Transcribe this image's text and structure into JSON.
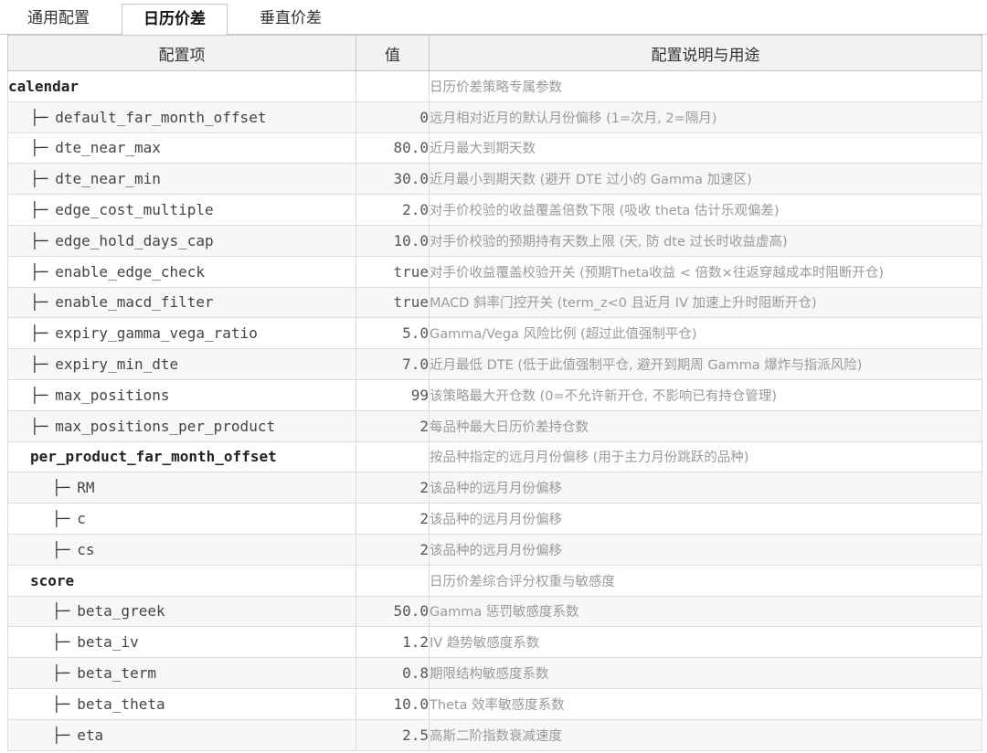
{
  "tabs": [
    {
      "label": "通用配置",
      "active": false
    },
    {
      "label": "日历价差",
      "active": true
    },
    {
      "label": "垂直价差",
      "active": false
    }
  ],
  "table": {
    "headers": {
      "key": "配置项",
      "value": "值",
      "description": "配置说明与用途"
    },
    "branch_glyph": "├─",
    "rows": [
      {
        "level": 0,
        "section": true,
        "key": "calendar",
        "value": "",
        "description": "日历价差策略专属参数"
      },
      {
        "level": 1,
        "section": false,
        "key": "default_far_month_offset",
        "value": "0",
        "description": "远月相对近月的默认月份偏移 (1=次月, 2=隔月)"
      },
      {
        "level": 1,
        "section": false,
        "key": "dte_near_max",
        "value": "80.0",
        "description": "近月最大到期天数"
      },
      {
        "level": 1,
        "section": false,
        "key": "dte_near_min",
        "value": "30.0",
        "description": "近月最小到期天数 (避开 DTE 过小的 Gamma 加速区)"
      },
      {
        "level": 1,
        "section": false,
        "key": "edge_cost_multiple",
        "value": "2.0",
        "description": "对手价校验的收益覆盖倍数下限 (吸收 theta 估计乐观偏差)"
      },
      {
        "level": 1,
        "section": false,
        "key": "edge_hold_days_cap",
        "value": "10.0",
        "description": "对手价校验的预期持有天数上限 (天, 防 dte 过长时收益虚高)"
      },
      {
        "level": 1,
        "section": false,
        "key": "enable_edge_check",
        "value": "true",
        "description": "对手价收益覆盖校验开关 (预期Theta收益 < 倍数×往返穿越成本时阻断开仓)"
      },
      {
        "level": 1,
        "section": false,
        "key": "enable_macd_filter",
        "value": "true",
        "description": "MACD 斜率门控开关 (term_z<0 且近月 IV 加速上升时阻断开仓)"
      },
      {
        "level": 1,
        "section": false,
        "key": "expiry_gamma_vega_ratio",
        "value": "5.0",
        "description": "Gamma/Vega 风险比例 (超过此值强制平仓)"
      },
      {
        "level": 1,
        "section": false,
        "key": "expiry_min_dte",
        "value": "7.0",
        "description": "近月最低 DTE (低于此值强制平仓, 避开到期周 Gamma 爆炸与指派风险)"
      },
      {
        "level": 1,
        "section": false,
        "key": "max_positions",
        "value": "99",
        "description": "该策略最大开仓数 (0=不允许新开仓, 不影响已有持仓管理)"
      },
      {
        "level": 1,
        "section": false,
        "key": "max_positions_per_product",
        "value": "2",
        "description": "每品种最大日历价差持仓数"
      },
      {
        "level": 1,
        "section": true,
        "key": "per_product_far_month_offset",
        "value": "",
        "description": "按品种指定的远月月份偏移 (用于主力月份跳跃的品种)"
      },
      {
        "level": 2,
        "section": false,
        "key": "RM",
        "value": "2",
        "description": "该品种的远月月份偏移"
      },
      {
        "level": 2,
        "section": false,
        "key": "c",
        "value": "2",
        "description": "该品种的远月月份偏移"
      },
      {
        "level": 2,
        "section": false,
        "key": "cs",
        "value": "2",
        "description": "该品种的远月月份偏移"
      },
      {
        "level": 1,
        "section": true,
        "key": "score",
        "value": "",
        "description": "日历价差综合评分权重与敏感度"
      },
      {
        "level": 2,
        "section": false,
        "key": "beta_greek",
        "value": "50.0",
        "description": "Gamma 惩罚敏感度系数"
      },
      {
        "level": 2,
        "section": false,
        "key": "beta_iv",
        "value": "1.2",
        "description": "IV 趋势敏感度系数"
      },
      {
        "level": 2,
        "section": false,
        "key": "beta_term",
        "value": "0.8",
        "description": "期限结构敏感度系数"
      },
      {
        "level": 2,
        "section": false,
        "key": "beta_theta",
        "value": "10.0",
        "description": "Theta 效率敏感度系数"
      },
      {
        "level": 2,
        "section": false,
        "key": "eta",
        "value": "2.5",
        "description": "高斯二阶指数衰减速度"
      }
    ]
  }
}
